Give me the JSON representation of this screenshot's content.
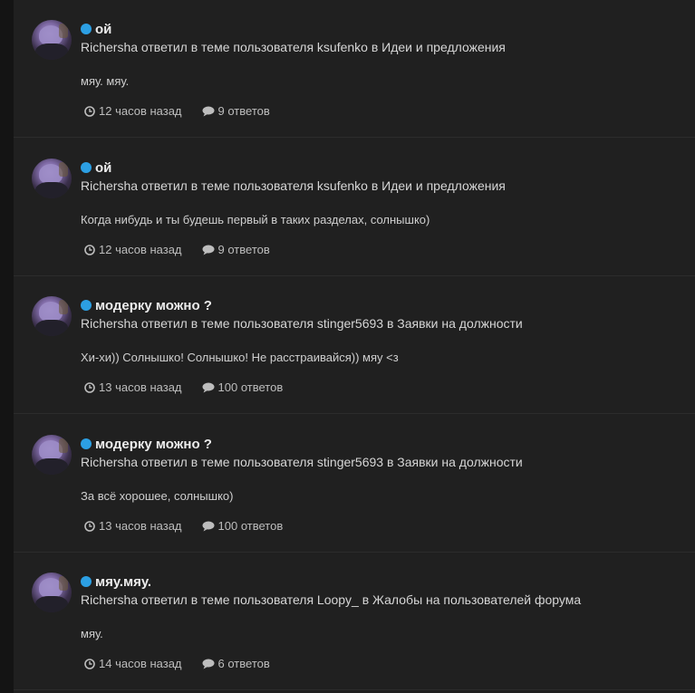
{
  "colors": {
    "background": "#202020",
    "unread_dot": "#2c9fe3",
    "title": "#ececec",
    "text": "#d6d6d6",
    "meta": "#bdbdbd"
  },
  "icons": {
    "avatar": "user-avatar",
    "unread": "unread-dot-icon",
    "time": "clock-icon",
    "replies": "comment-icon"
  },
  "items": [
    {
      "title": "ой",
      "action": "Richersha ответил в теме пользователя ksufenko в Идеи и предложения",
      "excerpt": "мяу. мяу.",
      "time": "12 часов назад",
      "replies": "9 ответов"
    },
    {
      "title": "ой",
      "action": "Richersha ответил в теме пользователя ksufenko в Идеи и предложения",
      "excerpt": "Когда нибудь и ты будешь первый в таких разделах, солнышко)",
      "time": "12 часов назад",
      "replies": "9 ответов"
    },
    {
      "title": "модерку можно ?",
      "action": "Richersha ответил в теме пользователя stinger5693 в Заявки на должности",
      "excerpt": "Хи-хи)) Солнышко! Солнышко! Не расстраивайся)) мяу <з",
      "time": "13 часов назад",
      "replies": "100 ответов"
    },
    {
      "title": "модерку можно ?",
      "action": "Richersha ответил в теме пользователя stinger5693 в Заявки на должности",
      "excerpt": "За всё хорошее, солнышко)",
      "time": "13 часов назад",
      "replies": "100 ответов"
    },
    {
      "title": "мяу.мяу.",
      "action": "Richersha ответил в теме пользователя Loopy_ в Жалобы на пользователей форума",
      "excerpt": "мяу.",
      "time": "14 часов назад",
      "replies": "6 ответов"
    }
  ]
}
